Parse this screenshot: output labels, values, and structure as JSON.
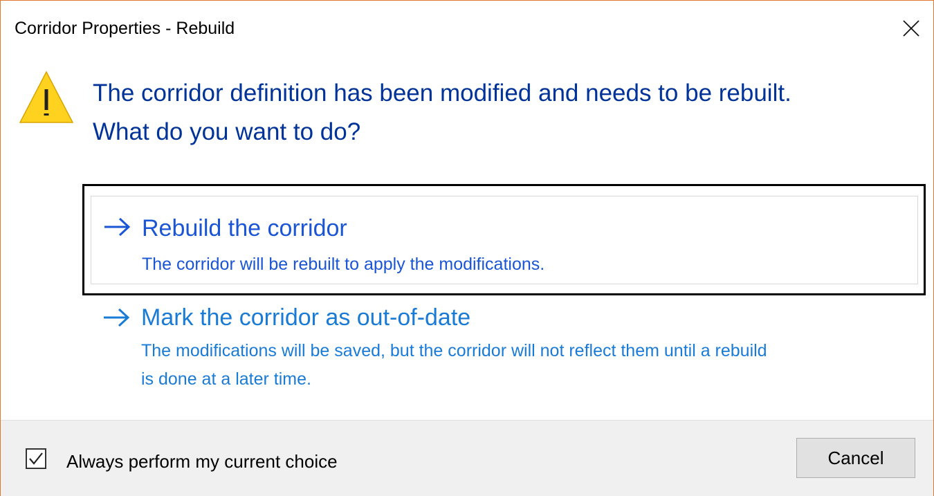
{
  "window": {
    "title": "Corridor Properties - Rebuild",
    "close_icon": "close-icon",
    "border_color": "#e0782f"
  },
  "main_instruction": {
    "icon": "warning-icon",
    "line1": "The corridor definition has been modified and needs to be rebuilt.",
    "line2": "What do you want to do?",
    "color": "#003399"
  },
  "options": [
    {
      "icon": "arrow-right-icon",
      "title": "Rebuild the corridor",
      "note": "The corridor will be rebuilt to apply the modifications.",
      "focused": true
    },
    {
      "icon": "arrow-right-icon",
      "title": "Mark the corridor as out-of-date",
      "note_line1": "The modifications will be saved, but the corridor will not reflect them until a rebuild",
      "note_line2": "is done at a later time.",
      "focused": false
    }
  ],
  "footer": {
    "checkbox_label": "Always perform my current choice",
    "checkbox_checked": true,
    "cancel_label": "Cancel"
  }
}
